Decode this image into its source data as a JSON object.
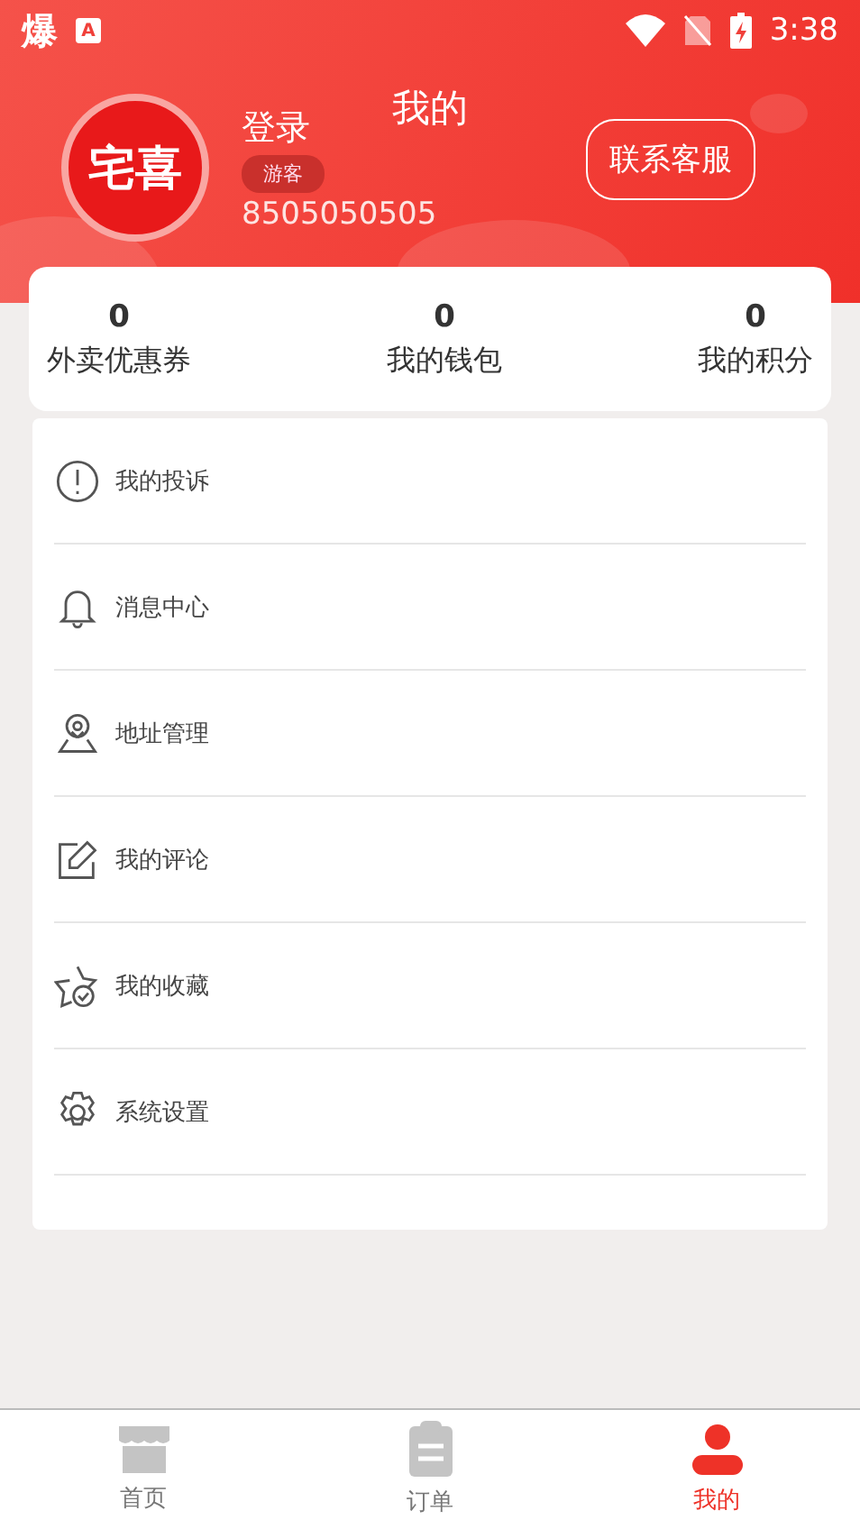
{
  "status_bar": {
    "app_glyph": "爆",
    "app_badge": "A",
    "time": "3:38"
  },
  "header": {
    "title": "我的",
    "logo_text": "宅喜",
    "login": "登录",
    "badge": "游客",
    "phone": "8505050505",
    "contact_button": "联系客服"
  },
  "stats": [
    {
      "value": "0",
      "label": "外卖优惠券"
    },
    {
      "value": "0",
      "label": "我的钱包"
    },
    {
      "value": "0",
      "label": "我的积分"
    }
  ],
  "menu": [
    {
      "label": "我的投诉"
    },
    {
      "label": "消息中心"
    },
    {
      "label": "地址管理"
    },
    {
      "label": "我的评论"
    },
    {
      "label": "我的收藏"
    },
    {
      "label": "系统设置"
    }
  ],
  "tab_bar": [
    {
      "label": "首页",
      "selected": false
    },
    {
      "label": "订单",
      "selected": false
    },
    {
      "label": "我的",
      "selected": true
    }
  ]
}
